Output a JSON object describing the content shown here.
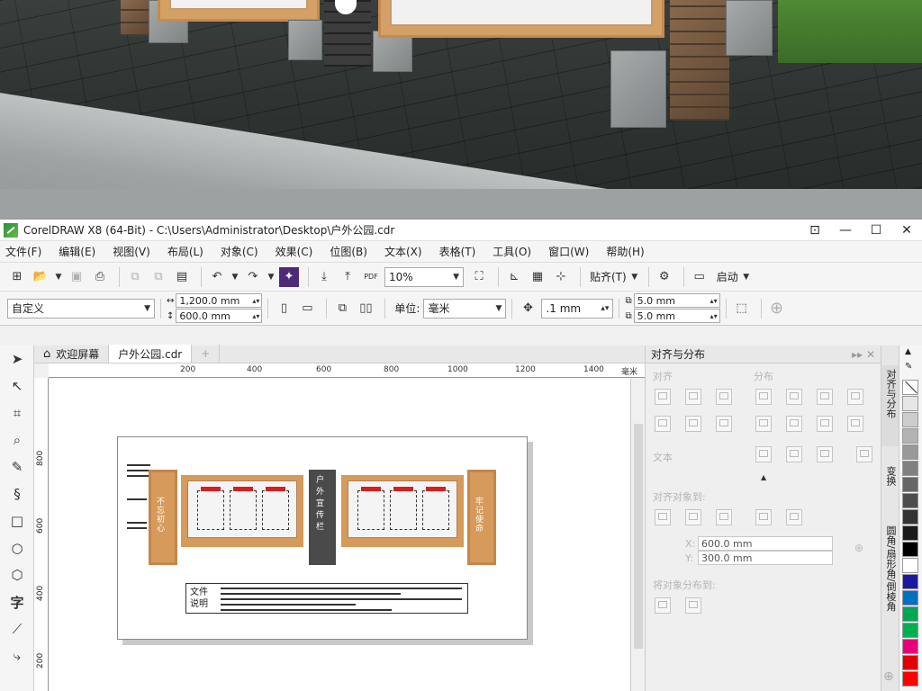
{
  "titlebar": {
    "title": "CorelDRAW X8 (64-Bit) - C:\\Users\\Administrator\\Desktop\\户外公园.cdr"
  },
  "menu": [
    "文件(F)",
    "编辑(E)",
    "视图(V)",
    "布局(L)",
    "对象(C)",
    "效果(C)",
    "位图(B)",
    "文本(X)",
    "表格(T)",
    "工具(O)",
    "窗口(W)",
    "帮助(H)"
  ],
  "toolbar": {
    "zoom": "10%",
    "snap_label": "贴齐(T)",
    "launch_label": "启动"
  },
  "propbar": {
    "preset": "自定义",
    "width": "1,200.0 mm",
    "height": "600.0 mm",
    "unit_label": "单位:",
    "unit": "毫米",
    "nudge": ".1 mm",
    "dup_x": "5.0 mm",
    "dup_y": "5.0 mm"
  },
  "tabs": {
    "welcome": "欢迎屏幕",
    "doc": "户外公园.cdr"
  },
  "ruler": {
    "h": [
      "200",
      "400",
      "600",
      "800",
      "1000",
      "1200",
      "1400"
    ],
    "unit": "毫米",
    "v": [
      "800",
      "600",
      "400",
      "200"
    ]
  },
  "artwork": {
    "left_pillar": "不忘初心",
    "center_pillar": "户外宣传栏",
    "right_pillar": "牢记使命",
    "doc_label_1": "文件",
    "doc_label_2": "说明"
  },
  "docker": {
    "title": "对齐与分布",
    "align": "对齐",
    "distribute": "分布",
    "text": "文本",
    "align_to": "对齐对象到:",
    "x_label": "X:",
    "x_value": "600.0 mm",
    "y_label": "Y:",
    "y_value": "300.0 mm",
    "distribute_to": "将对象分布到:"
  },
  "side_tabs": [
    "对齐与分布",
    "变换",
    "圆角/扇形角/倒棱角"
  ],
  "palette": [
    "#ffffff",
    "#e6e6e6",
    "#cccccc",
    "#b3b3b3",
    "#999999",
    "#808080",
    "#666666",
    "#4d4d4d",
    "#333333",
    "#1a1a1a",
    "#000000",
    "#ffffff",
    "#1a1aa0",
    "#0070c0",
    "#00a651",
    "#00b050",
    "#e6007e",
    "#e00000",
    "#ff0000"
  ]
}
